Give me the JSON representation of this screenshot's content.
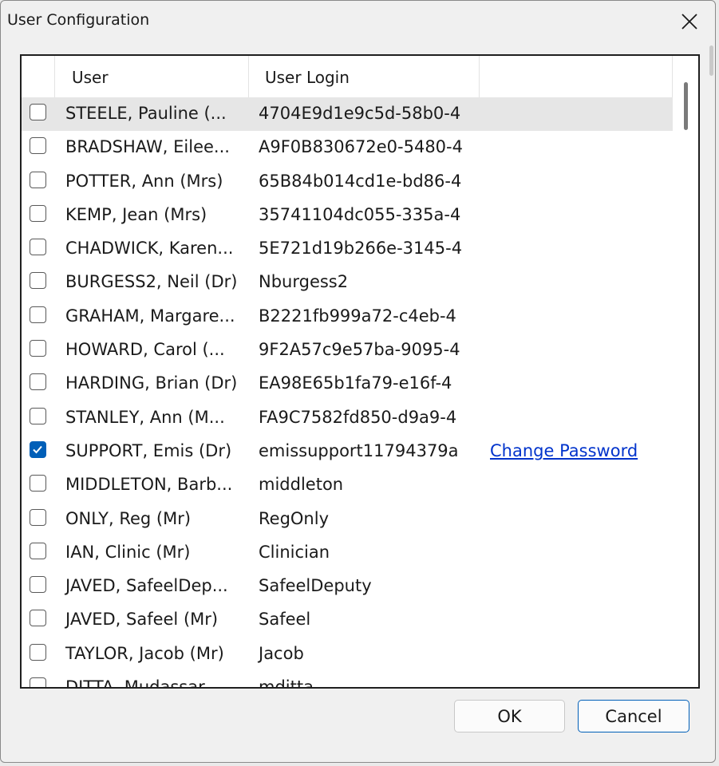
{
  "window": {
    "title": "User Configuration"
  },
  "list": {
    "columns": {
      "user": "User",
      "login": "User Login"
    },
    "rows": [
      {
        "user": "STEELE, Pauline (...",
        "login": "4704E9d1e9c5d-58b0-4",
        "checked": false,
        "selected": true,
        "action": ""
      },
      {
        "user": "BRADSHAW, Eilee...",
        "login": "A9F0B830672e0-5480-4",
        "checked": false,
        "selected": false,
        "action": ""
      },
      {
        "user": "POTTER, Ann (Mrs)",
        "login": "65B84b014cd1e-bd86-4",
        "checked": false,
        "selected": false,
        "action": ""
      },
      {
        "user": "KEMP, Jean (Mrs)",
        "login": "35741104dc055-335a-4",
        "checked": false,
        "selected": false,
        "action": ""
      },
      {
        "user": "CHADWICK, Karen...",
        "login": "5E721d19b266e-3145-4",
        "checked": false,
        "selected": false,
        "action": ""
      },
      {
        "user": "BURGESS2, Neil (Dr)",
        "login": "Nburgess2",
        "checked": false,
        "selected": false,
        "action": ""
      },
      {
        "user": "GRAHAM, Margare...",
        "login": "B2221fb999a72-c4eb-4",
        "checked": false,
        "selected": false,
        "action": ""
      },
      {
        "user": "HOWARD, Carol (...",
        "login": "9F2A57c9e57ba-9095-4",
        "checked": false,
        "selected": false,
        "action": ""
      },
      {
        "user": "HARDING, Brian (Dr)",
        "login": "EA98E65b1fa79-e16f-4",
        "checked": false,
        "selected": false,
        "action": ""
      },
      {
        "user": "STANLEY, Ann (M...",
        "login": "FA9C7582fd850-d9a9-4",
        "checked": false,
        "selected": false,
        "action": ""
      },
      {
        "user": "SUPPORT, Emis (Dr)",
        "login": "emissupport11794379a",
        "checked": true,
        "selected": false,
        "action": "Change Password"
      },
      {
        "user": "MIDDLETON, Barb...",
        "login": "middleton",
        "checked": false,
        "selected": false,
        "action": ""
      },
      {
        "user": "ONLY, Reg (Mr)",
        "login": "RegOnly",
        "checked": false,
        "selected": false,
        "action": ""
      },
      {
        "user": "IAN, Clinic (Mr)",
        "login": "Clinician",
        "checked": false,
        "selected": false,
        "action": ""
      },
      {
        "user": "JAVED, SafeelDep...",
        "login": "SafeelDeputy",
        "checked": false,
        "selected": false,
        "action": ""
      },
      {
        "user": "JAVED, Safeel (Mr)",
        "login": "Safeel",
        "checked": false,
        "selected": false,
        "action": ""
      },
      {
        "user": "TAYLOR, Jacob (Mr)",
        "login": "Jacob",
        "checked": false,
        "selected": false,
        "action": ""
      },
      {
        "user": "DITTA, Mudassar...",
        "login": "mditta",
        "checked": false,
        "selected": false,
        "action": ""
      }
    ]
  },
  "buttons": {
    "ok": "OK",
    "cancel": "Cancel"
  },
  "icons": {
    "close": "close-icon",
    "checkmark": "checkmark-icon"
  },
  "colors": {
    "accent": "#005fb8",
    "link": "#0033cc",
    "selected_row": "#e6e6e6"
  }
}
